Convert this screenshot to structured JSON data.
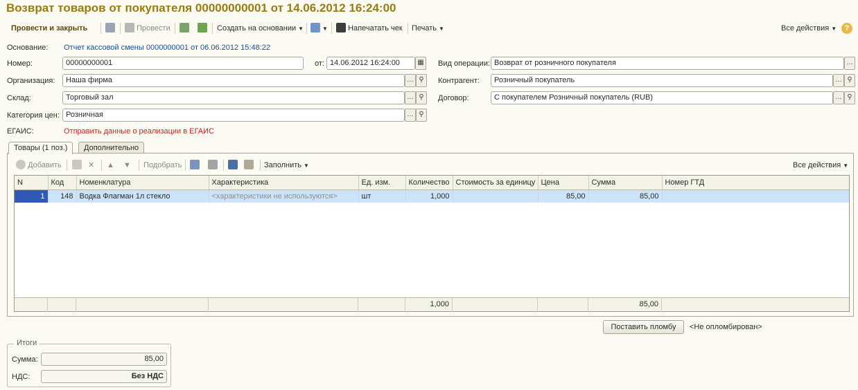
{
  "window": {
    "title": "Возврат товаров от покупателя 00000000001 от 14.06.2012 16:24:00"
  },
  "toolbar": {
    "post_close": "Провести и закрыть",
    "post": "Провести",
    "create_based": "Создать на основании",
    "print_check": "Напечатать чек",
    "print": "Печать",
    "all_actions": "Все действия",
    "help": "?"
  },
  "header": {
    "basis_label": "Основание:",
    "basis_link": "Отчет кассовой смены 0000000001 от 06.06.2012 15:48:22",
    "number_label": "Номер:",
    "number_value": "00000000001",
    "date_label": "от:",
    "date_value": "14.06.2012 16:24:00",
    "org_label": "Организация:",
    "org_value": "Наша фирма",
    "warehouse_label": "Склад:",
    "warehouse_value": "Торговый зал",
    "price_cat_label": "Категория цен:",
    "price_cat_value": "Розничная",
    "egais_label": "ЕГАИС:",
    "egais_link": "Отправить данные о реализации в ЕГАИС",
    "op_label": "Вид операции:",
    "op_value": "Возврат от розничного покупателя",
    "contractor_label": "Контрагент:",
    "contractor_value": "Розничный покупатель",
    "contract_label": "Договор:",
    "contract_value": "С покупателем Розничный покупатель (RUB)"
  },
  "tabs": [
    {
      "label": "Товары (1 поз.)"
    },
    {
      "label": "Дополнительно"
    }
  ],
  "grid_toolbar": {
    "add": "Добавить",
    "pick": "Подобрать",
    "fill": "Заполнить",
    "all_actions": "Все действия"
  },
  "table": {
    "columns": [
      "N",
      "Код",
      "Номенклатура",
      "Характеристика",
      "Ед. изм.",
      "Количество",
      "Стоимость за единицу",
      "Цена",
      "Сумма",
      "Номер ГТД"
    ],
    "rows": [
      {
        "n": "1",
        "code": "148",
        "item": "Водка Флагман 1л стекло",
        "char": "<характеристики не используются>",
        "unit": "шт",
        "qty": "1,000",
        "unit_cost": "",
        "price": "85,00",
        "sum": "85,00",
        "gtd": ""
      }
    ],
    "totals": {
      "qty": "1,000",
      "sum": "85,00"
    }
  },
  "seal": {
    "button": "Поставить пломбу",
    "status": "<Не опломбирован>"
  },
  "totals": {
    "group_title": "Итоги",
    "sum_label": "Сумма:",
    "sum_value": "85,00",
    "vat_label": "НДС:",
    "vat_value": "Без НДС"
  }
}
